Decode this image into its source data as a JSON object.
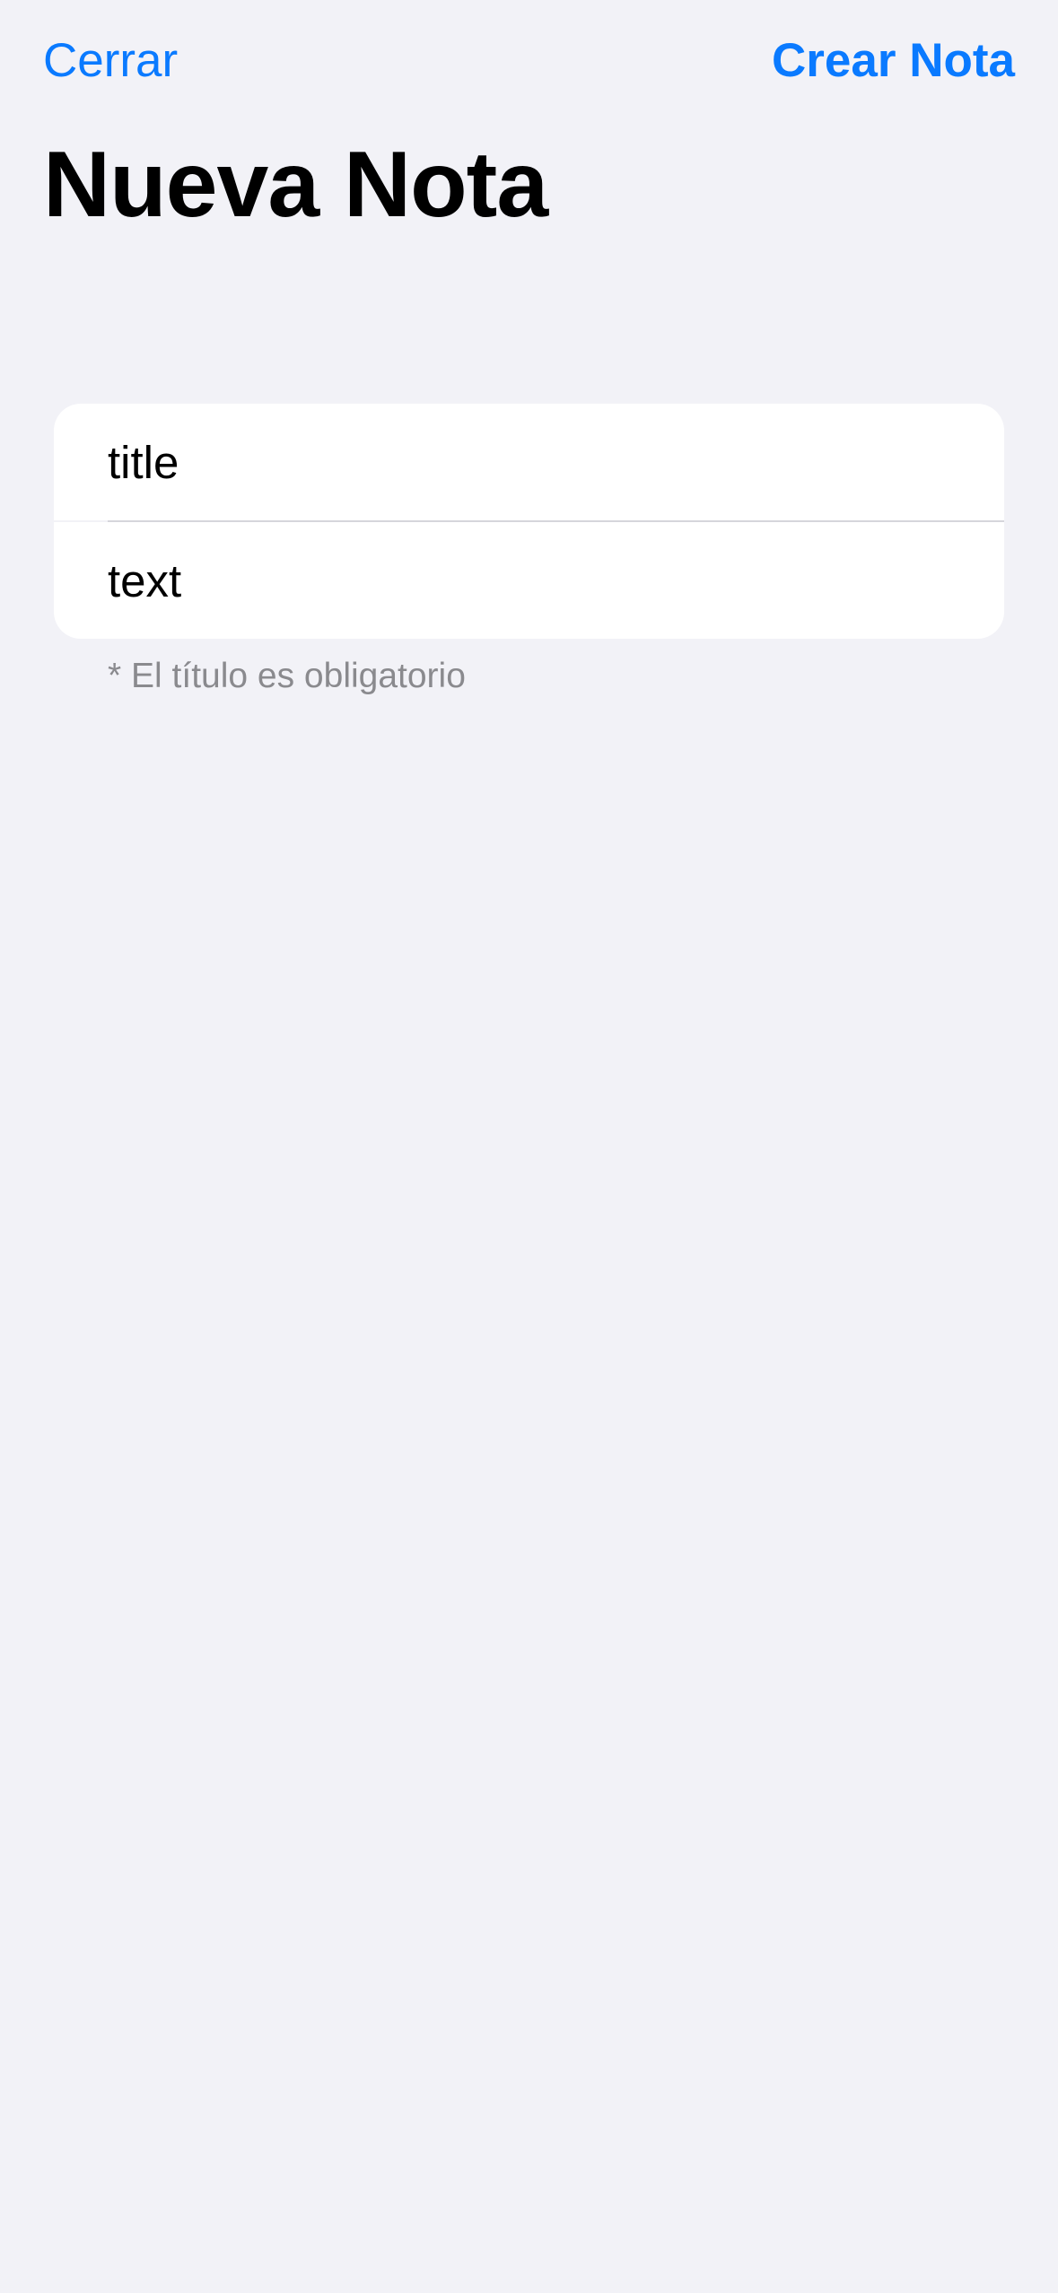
{
  "nav": {
    "close_label": "Cerrar",
    "create_label": "Crear Nota"
  },
  "page": {
    "title": "Nueva Nota"
  },
  "form": {
    "title_field": {
      "placeholder": "title",
      "value": ""
    },
    "text_field": {
      "placeholder": "text",
      "value": ""
    },
    "hint": "* El título es obligatorio"
  },
  "colors": {
    "accent": "#0A7AFF",
    "background": "#F2F2F7",
    "card": "#FFFFFF",
    "hint_text": "#8A8A8E",
    "separator": "#D6D6DB"
  }
}
